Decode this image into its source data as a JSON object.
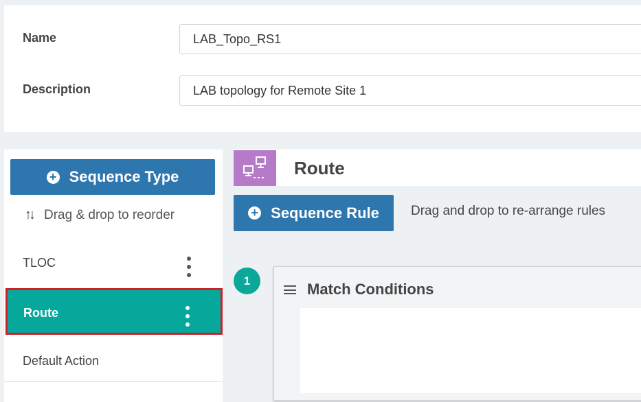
{
  "form": {
    "name_label": "Name",
    "name_value": "LAB_Topo_RS1",
    "description_label": "Description",
    "description_value": "LAB topology for Remote Site 1"
  },
  "sidebar": {
    "sequence_type_button": "Sequence Type",
    "drag_hint": "Drag & drop to reorder",
    "items": [
      {
        "label": "TLOC",
        "active": false,
        "has_menu": true
      },
      {
        "label": "Route",
        "active": true,
        "has_menu": true
      },
      {
        "label": "Default Action",
        "active": false,
        "has_menu": false
      }
    ]
  },
  "main": {
    "section_icon": "route-policy-icon",
    "section_title": "Route",
    "sequence_rule_button": "Sequence Rule",
    "rule_hint": "Drag and drop to re-arrange rules",
    "rules": [
      {
        "number": "1",
        "title": "Match Conditions"
      }
    ]
  },
  "colors": {
    "primary_button": "#2d76ae",
    "active_item": "#06a89c",
    "highlight_outline": "#d11f26",
    "route_icon_bg": "#b57bc8",
    "step_badge": "#0aa898"
  }
}
